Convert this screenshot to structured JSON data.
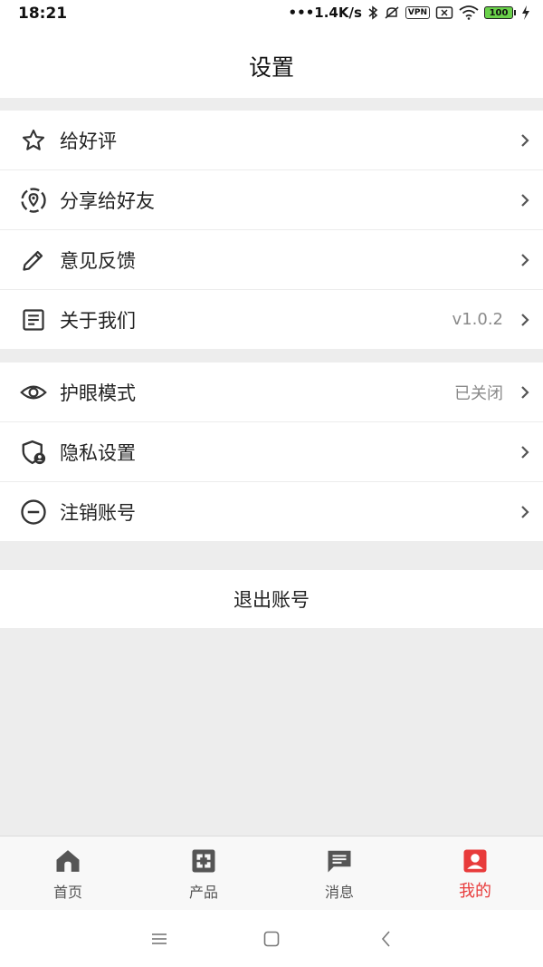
{
  "status_bar": {
    "time": "18:21",
    "speed": "•••1.4K/s",
    "vpn": "VPN",
    "battery": "100"
  },
  "header": {
    "title": "设置"
  },
  "group1": [
    {
      "label": "给好评",
      "value": "",
      "icon": "star-icon"
    },
    {
      "label": "分享给好友",
      "value": "",
      "icon": "share-location-icon"
    },
    {
      "label": "意见反馈",
      "value": "",
      "icon": "pencil-icon"
    },
    {
      "label": "关于我们",
      "value": "v1.0.2",
      "icon": "document-icon"
    }
  ],
  "group2": [
    {
      "label": "护眼模式",
      "value": "已关闭",
      "icon": "eye-icon"
    },
    {
      "label": "隐私设置",
      "value": "",
      "icon": "shield-user-icon"
    },
    {
      "label": "注销账号",
      "value": "",
      "icon": "minus-circle-icon"
    }
  ],
  "logout_label": "退出账号",
  "tabbar": [
    {
      "label": "首页",
      "icon": "home-icon",
      "active": false
    },
    {
      "label": "产品",
      "icon": "product-icon",
      "active": false
    },
    {
      "label": "消息",
      "icon": "message-icon",
      "active": false
    },
    {
      "label": "我的",
      "icon": "profile-icon",
      "active": true
    }
  ],
  "colors": {
    "accent": "#e83b3b",
    "background": "#ededed",
    "text": "#222222",
    "muted": "#8a8a8a"
  }
}
